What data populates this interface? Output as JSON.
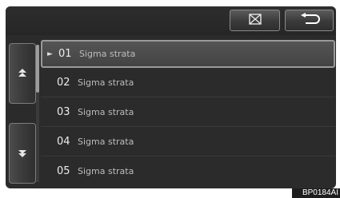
{
  "toolbar": {
    "close_icon": "close-box-icon",
    "back_icon": "return-arrow-icon"
  },
  "side": {
    "up_icon": "page-up-icon",
    "down_icon": "page-down-icon"
  },
  "tracks": [
    {
      "number": "01",
      "name": "Sigma strata",
      "selected": true,
      "marker": "►"
    },
    {
      "number": "02",
      "name": "Sigma strata",
      "selected": false,
      "marker": ""
    },
    {
      "number": "03",
      "name": "Sigma strata",
      "selected": false,
      "marker": ""
    },
    {
      "number": "04",
      "name": "Sigma strata",
      "selected": false,
      "marker": ""
    },
    {
      "number": "05",
      "name": "Sigma strata",
      "selected": false,
      "marker": ""
    }
  ],
  "figure_code": "BP0184AI"
}
